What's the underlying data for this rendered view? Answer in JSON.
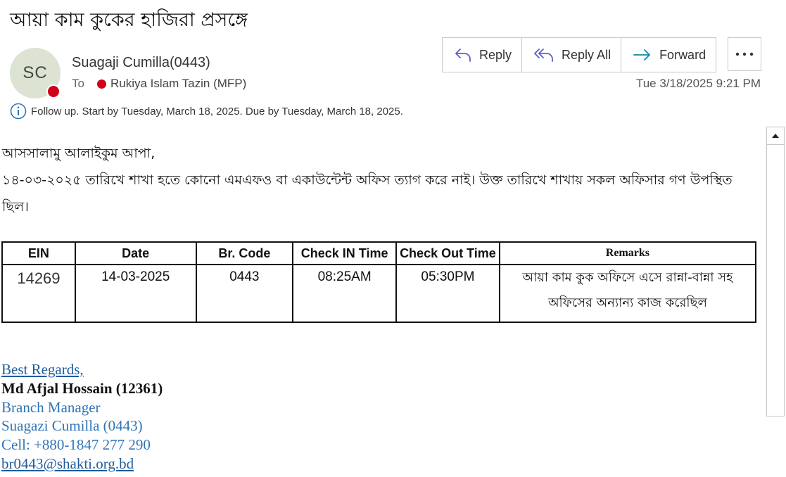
{
  "email": {
    "subject": "আয়া কাম কুকের হাজিরা প্রসঙ্গে",
    "avatar_initials": "SC",
    "sender": "Suagaji Cumilla(0443)",
    "to_label": "To",
    "recipient": "Rukiya Islam Tazin (MFP)",
    "date": "Tue 3/18/2025 9:21 PM",
    "followup": "Follow up.  Start by Tuesday, March 18, 2025.  Due by Tuesday, March 18, 2025."
  },
  "actions": {
    "reply": "Reply",
    "reply_all": "Reply All",
    "forward": "Forward"
  },
  "body": {
    "greeting": "আসসালামু আলাইকুম আপা,",
    "line1": "১৪-০৩-২০২৫ তারিখে শাখা হতে কোনো এমএফও বা একাউন্টেন্ট অফিস ত্যাগ করে নাই। উক্ত তারিখে শাখায় সকল অফিসার গণ উপস্থিত",
    "line2": "ছিল।"
  },
  "table": {
    "headers": [
      "EIN",
      "Date",
      "Br. Code",
      "Check IN Time",
      "Check Out Time",
      "Remarks"
    ],
    "row": {
      "ein": "14269",
      "date": "14-03-2025",
      "br_code": "0443",
      "check_in": "08:25AM",
      "check_out": "05:30PM",
      "remarks_line1": "আয়া কাম কুক অফিসে এসে রান্না-বান্না সহ",
      "remarks_line2": "অফিসের অন্যান্য কাজ করেছিল"
    }
  },
  "signature": {
    "regards": "Best Regards,",
    "name": "Md Afjal Hossain (12361)",
    "title": "Branch Manager",
    "branch": "Suagazi Cumilla (0443)",
    "cell": "Cell: +880-1847 277 290",
    "email": "br0443@shakti.org.bd"
  },
  "colors": {
    "accent": "#2e75b6",
    "presence": "#d0021b",
    "avatar_bg": "#dde3d3"
  }
}
